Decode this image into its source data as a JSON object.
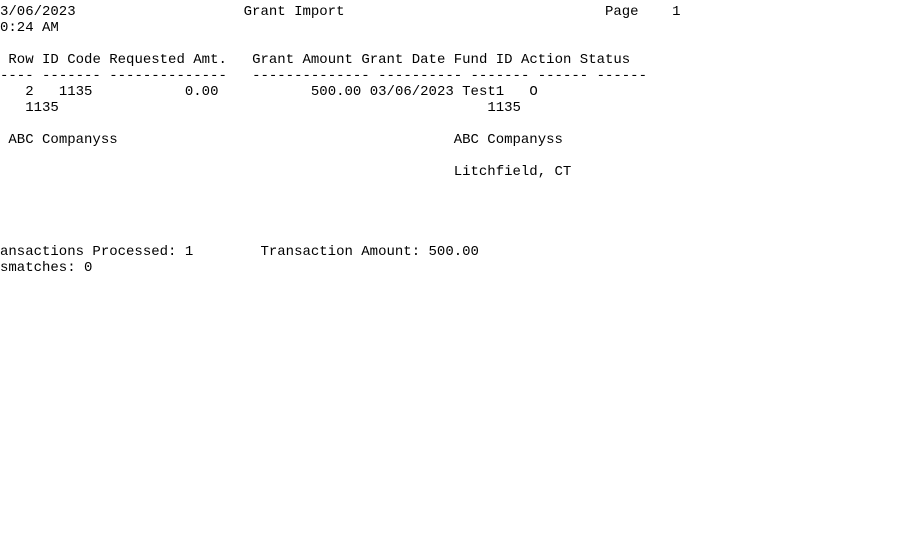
{
  "header": {
    "date": "3/06/2023",
    "title": "Grant Import",
    "page_label": "Page",
    "page_number": "1",
    "time": "0:24 AM"
  },
  "columns": {
    "row": "Row",
    "id_code": "ID Code",
    "requested_amt": "Requested Amt.",
    "grant_amount": "Grant Amount",
    "grant_date": "Grant Date",
    "fund_id": "Fund ID",
    "action": "Action",
    "status": "Status"
  },
  "rules": {
    "row": "----",
    "id_code": "-------",
    "requested_amt": "--------------",
    "grant_amount": "--------------",
    "grant_date": "----------",
    "fund_id": "-------",
    "action": "------",
    "status": "------"
  },
  "rows": [
    {
      "row": "2",
      "id_code": "1135",
      "requested_amt": "0.00",
      "grant_amount": "500.00",
      "grant_date": "03/06/2023",
      "fund_id": "Test1",
      "action": "O",
      "status": ""
    }
  ],
  "detail": {
    "secondary_id": "1135",
    "secondary_code": "1135",
    "left_name": "ABC Companyss",
    "right_name": "ABC Companyss",
    "city_state": "Litchfield, CT"
  },
  "footer": {
    "transactions_processed_label": "ansactions Processed:",
    "transactions_processed_value": "1",
    "transaction_amount_label": "Transaction Amount:",
    "transaction_amount_value": "500.00",
    "mismatches_label": "smatches:",
    "mismatches_value": "0"
  }
}
